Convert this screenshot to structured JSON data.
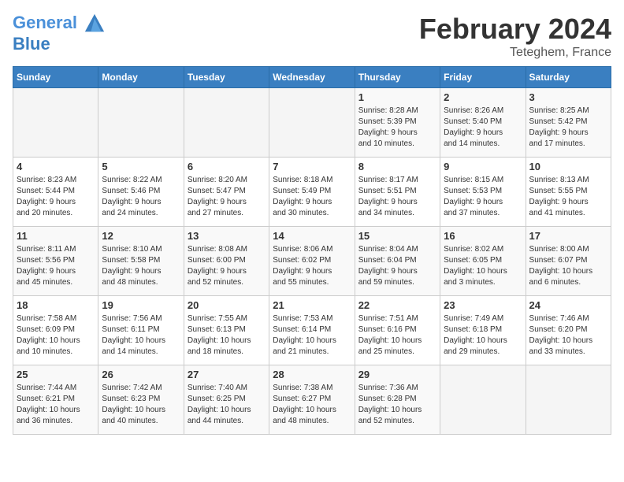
{
  "header": {
    "logo_line1": "General",
    "logo_line2": "Blue",
    "month": "February 2024",
    "location": "Teteghem, France"
  },
  "weekdays": [
    "Sunday",
    "Monday",
    "Tuesday",
    "Wednesday",
    "Thursday",
    "Friday",
    "Saturday"
  ],
  "weeks": [
    [
      {
        "day": "",
        "info": ""
      },
      {
        "day": "",
        "info": ""
      },
      {
        "day": "",
        "info": ""
      },
      {
        "day": "",
        "info": ""
      },
      {
        "day": "1",
        "info": "Sunrise: 8:28 AM\nSunset: 5:39 PM\nDaylight: 9 hours\nand 10 minutes."
      },
      {
        "day": "2",
        "info": "Sunrise: 8:26 AM\nSunset: 5:40 PM\nDaylight: 9 hours\nand 14 minutes."
      },
      {
        "day": "3",
        "info": "Sunrise: 8:25 AM\nSunset: 5:42 PM\nDaylight: 9 hours\nand 17 minutes."
      }
    ],
    [
      {
        "day": "4",
        "info": "Sunrise: 8:23 AM\nSunset: 5:44 PM\nDaylight: 9 hours\nand 20 minutes."
      },
      {
        "day": "5",
        "info": "Sunrise: 8:22 AM\nSunset: 5:46 PM\nDaylight: 9 hours\nand 24 minutes."
      },
      {
        "day": "6",
        "info": "Sunrise: 8:20 AM\nSunset: 5:47 PM\nDaylight: 9 hours\nand 27 minutes."
      },
      {
        "day": "7",
        "info": "Sunrise: 8:18 AM\nSunset: 5:49 PM\nDaylight: 9 hours\nand 30 minutes."
      },
      {
        "day": "8",
        "info": "Sunrise: 8:17 AM\nSunset: 5:51 PM\nDaylight: 9 hours\nand 34 minutes."
      },
      {
        "day": "9",
        "info": "Sunrise: 8:15 AM\nSunset: 5:53 PM\nDaylight: 9 hours\nand 37 minutes."
      },
      {
        "day": "10",
        "info": "Sunrise: 8:13 AM\nSunset: 5:55 PM\nDaylight: 9 hours\nand 41 minutes."
      }
    ],
    [
      {
        "day": "11",
        "info": "Sunrise: 8:11 AM\nSunset: 5:56 PM\nDaylight: 9 hours\nand 45 minutes."
      },
      {
        "day": "12",
        "info": "Sunrise: 8:10 AM\nSunset: 5:58 PM\nDaylight: 9 hours\nand 48 minutes."
      },
      {
        "day": "13",
        "info": "Sunrise: 8:08 AM\nSunset: 6:00 PM\nDaylight: 9 hours\nand 52 minutes."
      },
      {
        "day": "14",
        "info": "Sunrise: 8:06 AM\nSunset: 6:02 PM\nDaylight: 9 hours\nand 55 minutes."
      },
      {
        "day": "15",
        "info": "Sunrise: 8:04 AM\nSunset: 6:04 PM\nDaylight: 9 hours\nand 59 minutes."
      },
      {
        "day": "16",
        "info": "Sunrise: 8:02 AM\nSunset: 6:05 PM\nDaylight: 10 hours\nand 3 minutes."
      },
      {
        "day": "17",
        "info": "Sunrise: 8:00 AM\nSunset: 6:07 PM\nDaylight: 10 hours\nand 6 minutes."
      }
    ],
    [
      {
        "day": "18",
        "info": "Sunrise: 7:58 AM\nSunset: 6:09 PM\nDaylight: 10 hours\nand 10 minutes."
      },
      {
        "day": "19",
        "info": "Sunrise: 7:56 AM\nSunset: 6:11 PM\nDaylight: 10 hours\nand 14 minutes."
      },
      {
        "day": "20",
        "info": "Sunrise: 7:55 AM\nSunset: 6:13 PM\nDaylight: 10 hours\nand 18 minutes."
      },
      {
        "day": "21",
        "info": "Sunrise: 7:53 AM\nSunset: 6:14 PM\nDaylight: 10 hours\nand 21 minutes."
      },
      {
        "day": "22",
        "info": "Sunrise: 7:51 AM\nSunset: 6:16 PM\nDaylight: 10 hours\nand 25 minutes."
      },
      {
        "day": "23",
        "info": "Sunrise: 7:49 AM\nSunset: 6:18 PM\nDaylight: 10 hours\nand 29 minutes."
      },
      {
        "day": "24",
        "info": "Sunrise: 7:46 AM\nSunset: 6:20 PM\nDaylight: 10 hours\nand 33 minutes."
      }
    ],
    [
      {
        "day": "25",
        "info": "Sunrise: 7:44 AM\nSunset: 6:21 PM\nDaylight: 10 hours\nand 36 minutes."
      },
      {
        "day": "26",
        "info": "Sunrise: 7:42 AM\nSunset: 6:23 PM\nDaylight: 10 hours\nand 40 minutes."
      },
      {
        "day": "27",
        "info": "Sunrise: 7:40 AM\nSunset: 6:25 PM\nDaylight: 10 hours\nand 44 minutes."
      },
      {
        "day": "28",
        "info": "Sunrise: 7:38 AM\nSunset: 6:27 PM\nDaylight: 10 hours\nand 48 minutes."
      },
      {
        "day": "29",
        "info": "Sunrise: 7:36 AM\nSunset: 6:28 PM\nDaylight: 10 hours\nand 52 minutes."
      },
      {
        "day": "",
        "info": ""
      },
      {
        "day": "",
        "info": ""
      }
    ]
  ]
}
